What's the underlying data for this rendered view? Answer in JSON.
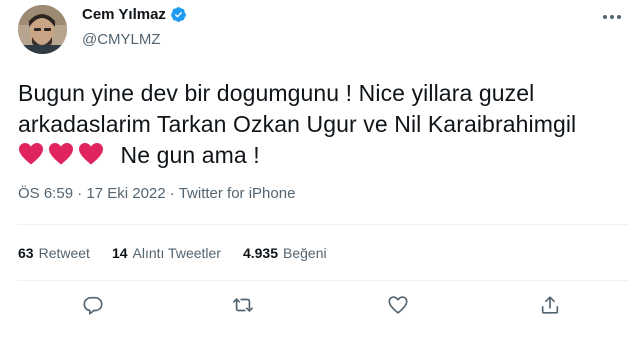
{
  "author": {
    "name": "Cem Yılmaz",
    "handle": "@CMYLMZ",
    "verified": true
  },
  "tweet": {
    "line1": "Bugun yine dev bir dogumgunu ! Nice yillara guzel",
    "line2": "arkadaslarim Tarkan Ozkan Ugur ve Nil Karaibrahimgil",
    "emoji_count": 3,
    "emoji_icon": "red-heart",
    "after_emoji": "Ne gun ama !"
  },
  "meta": {
    "time": "ÖS 6:59",
    "separator": " · ",
    "date": "17 Eki 2022",
    "source": "Twitter for iPhone"
  },
  "stats": {
    "retweets_count": "63",
    "retweets_label": "Retweet",
    "quotes_count": "14",
    "quotes_label": "Alıntı Tweetler",
    "likes_count": "4.935",
    "likes_label": "Beğeni"
  },
  "actions": [
    "reply-icon",
    "retweet-icon",
    "like-icon",
    "share-icon"
  ],
  "colors": {
    "text": "#0f1419",
    "secondary": "#536471",
    "verified": "#1d9bf0",
    "heart": "#e0245e",
    "divider": "#eff3f4"
  }
}
